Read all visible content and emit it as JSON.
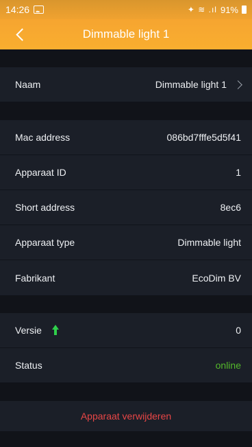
{
  "statusbar": {
    "time": "14:26",
    "image_icon": "gallery-icon",
    "signal_symbols": "✦ ≋ .ıl",
    "battery_text": "91%"
  },
  "header": {
    "title": "Dimmable light 1",
    "back_icon": "chevron-left-icon"
  },
  "name_section": {
    "label": "Naam",
    "value": "Dimmable light 1"
  },
  "info": [
    {
      "label": "Mac address",
      "value": "086bd7fffe5d5f41"
    },
    {
      "label": "Apparaat ID",
      "value": "1"
    },
    {
      "label": "Short address",
      "value": "8ec6"
    },
    {
      "label": "Apparaat type",
      "value": "Dimmable light"
    },
    {
      "label": "Fabrikant",
      "value": "EcoDim BV"
    }
  ],
  "version": {
    "label": "Versie",
    "value": "0",
    "icon": "arrow-up-icon"
  },
  "status": {
    "label": "Status",
    "value": "online",
    "color": "#54b82b"
  },
  "delete_label": "Apparaat verwijderen",
  "colors": {
    "accent": "#f6a530",
    "background": "#111319",
    "row": "#1b1f28",
    "danger": "#e84646",
    "upgrade": "#2fd04b"
  }
}
